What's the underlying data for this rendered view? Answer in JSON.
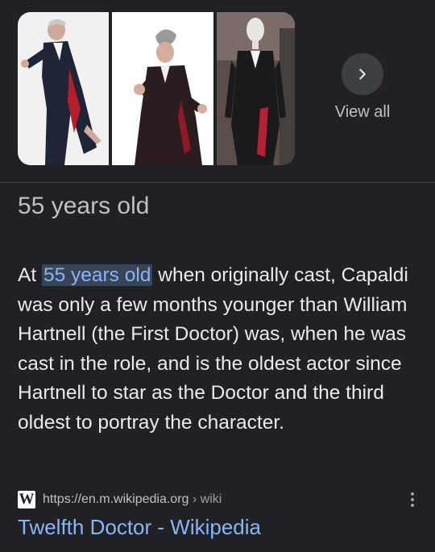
{
  "images": {
    "items": [
      {
        "name": "image-1",
        "subject": "person in dark coat, pointing"
      },
      {
        "name": "image-2",
        "subject": "person in long coat, gesturing"
      },
      {
        "name": "image-3",
        "subject": "costume on mannequin"
      }
    ]
  },
  "view_all": {
    "label": "View all",
    "icon": "chevron-right-icon"
  },
  "answer": {
    "text": "55 years old"
  },
  "snippet": {
    "before": "At ",
    "highlight": "55 years old",
    "after": " when originally cast, Capaldi was only a few months younger than William Hartnell (the First Doctor) was, when he was cast in the role, and is the oldest actor since Hartnell to star as the Doctor and the third oldest to portray the character."
  },
  "source": {
    "logo_letter": "W",
    "logo_icon": "wikipedia-icon",
    "url": "https://en.m.wikipedia.org",
    "path": " › wiki",
    "more_icon": "more-vert-icon"
  },
  "result": {
    "title": "Twelfth Doctor - Wikipedia"
  },
  "colors": {
    "background": "#202124",
    "link": "#8ab4f8",
    "highlight_bg": "#394457",
    "text": "#e8eaed",
    "muted": "#bdc1c6"
  }
}
